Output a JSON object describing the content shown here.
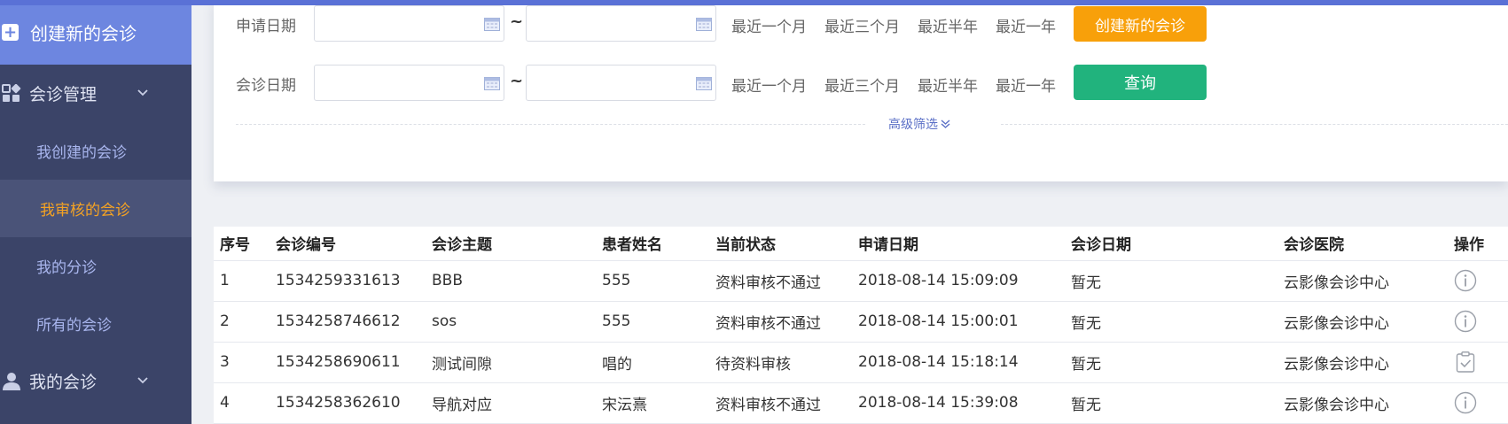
{
  "sidebar": {
    "create_label": "创建新的会诊",
    "groups": [
      {
        "label": "会诊管理",
        "icon": "grid-icon"
      },
      {
        "label": "我的会诊",
        "icon": "user-icon"
      }
    ],
    "items": [
      {
        "label": "我创建的会诊"
      },
      {
        "label": "我审核的会诊",
        "active": true
      },
      {
        "label": "我的分诊"
      },
      {
        "label": "所有的会诊"
      }
    ]
  },
  "filters": {
    "apply_date_label": "申请日期",
    "consult_date_label": "会诊日期",
    "range_separator": "~",
    "quick_ranges": [
      "最近一个月",
      "最近三个月",
      "最近半年",
      "最近一年"
    ],
    "create_button": "创建新的会诊",
    "query_button": "查询",
    "advanced_label": "高级筛选"
  },
  "table": {
    "columns": [
      "序号",
      "会诊编号",
      "会诊主题",
      "患者姓名",
      "当前状态",
      "申请日期",
      "会诊日期",
      "会诊医院",
      "操作"
    ],
    "rows": [
      {
        "index": "1",
        "id": "1534259331613",
        "topic": "BBB",
        "patient": "555",
        "status": "资料审核不通过",
        "apply_date": "2018-08-14 15:09:09",
        "consult_date": "暂无",
        "hospital": "云影像会诊中心",
        "action_icon": "info-icon"
      },
      {
        "index": "2",
        "id": "1534258746612",
        "topic": "sos",
        "patient": "555",
        "status": "资料审核不通过",
        "apply_date": "2018-08-14 15:00:01",
        "consult_date": "暂无",
        "hospital": "云影像会诊中心",
        "action_icon": "info-icon"
      },
      {
        "index": "3",
        "id": "1534258690611",
        "topic": "测试间隙",
        "patient": "唱的",
        "status": "待资料审核",
        "apply_date": "2018-08-14 15:18:14",
        "consult_date": "暂无",
        "hospital": "云影像会诊中心",
        "action_icon": "clipboard-check-icon"
      },
      {
        "index": "4",
        "id": "1534258362610",
        "topic": "导航对应",
        "patient": "宋沄熹",
        "status": "资料审核不通过",
        "apply_date": "2018-08-14 15:39:08",
        "consult_date": "暂无",
        "hospital": "云影像会诊中心",
        "action_icon": "info-icon"
      }
    ]
  },
  "colors": {
    "accent": "#5a71d6",
    "sidebar_bg": "#3b4468",
    "active_item": "#f5a323",
    "create_button": "#f8a00a",
    "query_button": "#21b37d"
  }
}
